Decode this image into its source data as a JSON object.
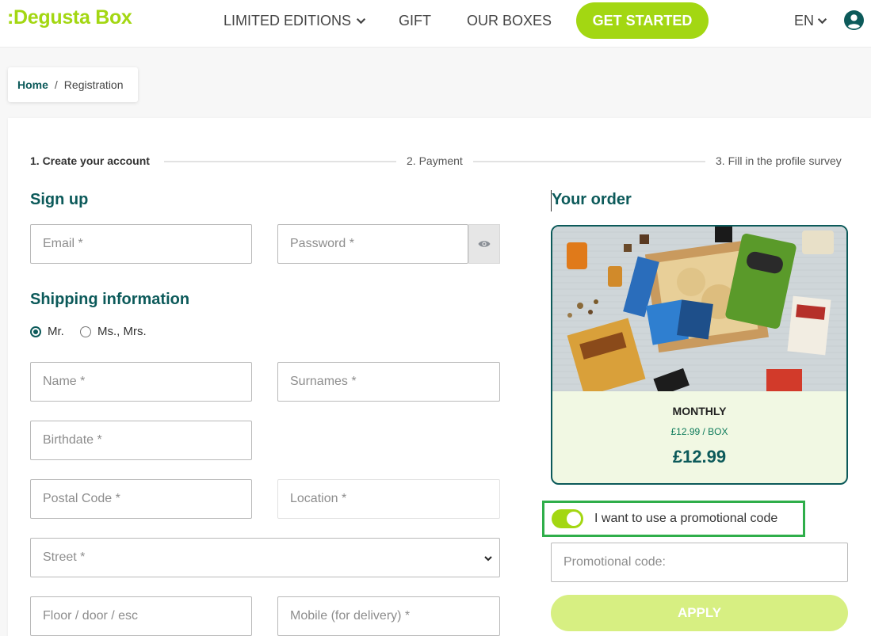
{
  "header": {
    "logo": ":Degusta Box",
    "nav": {
      "limited_editions": "LIMITED EDITIONS",
      "gift": "GIFT",
      "our_boxes": "OUR BOXES"
    },
    "cta": "GET STARTED",
    "language": "EN",
    "icons": {
      "dropdown": "chevron-down-icon",
      "user": "user-circle-icon"
    }
  },
  "breadcrumb": {
    "home": "Home",
    "separator": "/",
    "current": "Registration"
  },
  "steps": [
    {
      "label": "1. Create your account",
      "active": true
    },
    {
      "label": "2. Payment",
      "active": false
    },
    {
      "label": "3. Fill in the profile survey",
      "active": false
    }
  ],
  "signup": {
    "title": "Sign up",
    "email_placeholder": "Email *",
    "password_placeholder": "Password *",
    "eye_icon": "eye-icon"
  },
  "shipping": {
    "title": "Shipping information",
    "title_options": [
      {
        "label": "Mr.",
        "checked": true
      },
      {
        "label": "Ms., Mrs.",
        "checked": false
      }
    ],
    "name_placeholder": "Name *",
    "surnames_placeholder": "Surnames *",
    "birthdate_placeholder": "Birthdate *",
    "postal_code_placeholder": "Postal Code *",
    "location_placeholder": "Location *",
    "street_placeholder": "Street *",
    "floor_placeholder": "Floor / door / esc",
    "mobile_placeholder": "Mobile (for delivery) *"
  },
  "order": {
    "title": "Your order",
    "plan": "MONTHLY",
    "price_per_box": "£12.99 / BOX",
    "price": "£12.99",
    "image_label": "Degusta Box products"
  },
  "promo": {
    "toggle_on": true,
    "label": "I want to use a promotional code",
    "code_placeholder": "Promotional code:",
    "apply": "APPLY"
  },
  "colors": {
    "brand_green": "#a3d712",
    "teal": "#0c5a5a",
    "highlight_border": "#2fae4a",
    "order_bg": "#f1f8e3"
  }
}
